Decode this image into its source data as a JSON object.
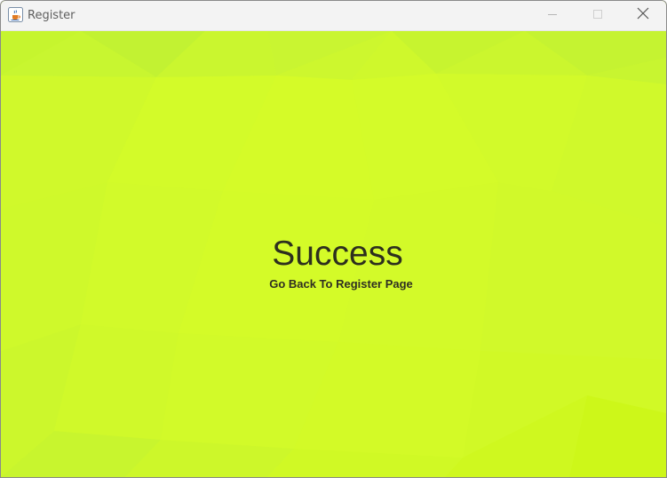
{
  "window": {
    "title": "Register",
    "icon": "java-cup-icon"
  },
  "titlebar_buttons": {
    "minimize": "minimize-icon",
    "maximize": "maximize-icon",
    "close": "close-icon"
  },
  "main": {
    "heading": "Success",
    "back_link": "Go Back To Register Page"
  },
  "colors": {
    "background": "#d2f82a",
    "titlebar": "#f3f3f3",
    "text": "#2d2f1e"
  }
}
